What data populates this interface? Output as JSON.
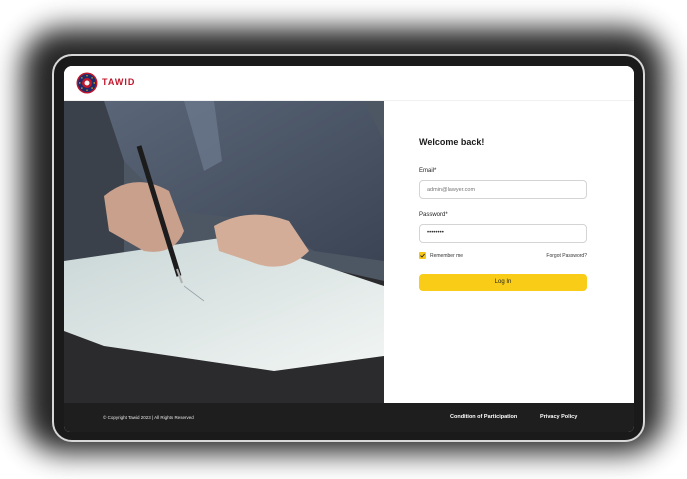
{
  "app": {
    "brand": "TAWID",
    "logo_icon": "tawid-seal-icon",
    "brand_color": "#c0162b"
  },
  "hero": {
    "image": "hand-signing-document-photo"
  },
  "login": {
    "welcome": "Welcome back!",
    "email_label": "Email*",
    "email_placeholder": "admin@lawyer.com",
    "password_label": "Password*",
    "password_value": "••••••••",
    "remember_label": "Remember me",
    "remember_checked": true,
    "forgot_label": "Forgot Password?",
    "submit_label": "Log In",
    "accent": "#f8cc17"
  },
  "footer": {
    "copyright": "© Copyright Tawid 2023 | All Rights Reserved",
    "links": [
      "Condition of Participation",
      "Privacy Policy"
    ]
  }
}
